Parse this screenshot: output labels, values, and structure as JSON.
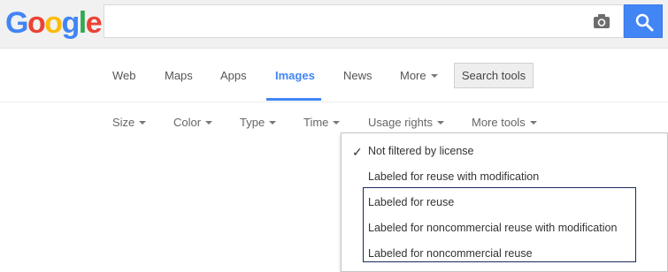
{
  "logo": {
    "letters": [
      "G",
      "o",
      "o",
      "g",
      "l",
      "e"
    ],
    "colors": [
      "#4285f4",
      "#ea4335",
      "#fbbc05",
      "#4285f4",
      "#34a853",
      "#ea4335"
    ]
  },
  "search": {
    "value": "",
    "placeholder": ""
  },
  "icons": {
    "camera": "camera-icon",
    "search": "magnifier-icon"
  },
  "tabs": [
    {
      "label": "Web"
    },
    {
      "label": "Maps"
    },
    {
      "label": "Apps"
    },
    {
      "label": "Images",
      "active": true
    },
    {
      "label": "News"
    },
    {
      "label": "More"
    }
  ],
  "search_tools_label": "Search tools",
  "filters": [
    {
      "label": "Size"
    },
    {
      "label": "Color"
    },
    {
      "label": "Type"
    },
    {
      "label": "Time"
    },
    {
      "label": "Usage rights"
    },
    {
      "label": "More tools"
    }
  ],
  "usage_rights_menu": {
    "items": [
      {
        "label": "Not filtered by license",
        "checked": true
      },
      {
        "label": "Labeled for reuse with modification"
      },
      {
        "label": "Labeled for reuse"
      },
      {
        "label": "Labeled for noncommercial reuse with modification"
      },
      {
        "label": "Labeled for noncommercial reuse"
      }
    ]
  },
  "colors": {
    "accent": "#4285f4",
    "highlight_border": "#1b2a5b"
  }
}
